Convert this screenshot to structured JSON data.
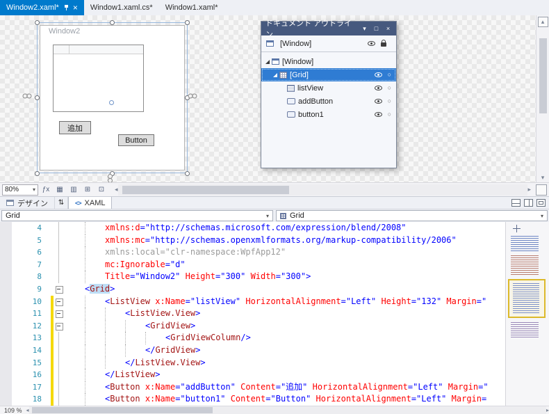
{
  "tabs": [
    {
      "label": "Window2.xaml*",
      "active": true
    },
    {
      "label": "Window1.xaml.cs*",
      "active": false
    },
    {
      "label": "Window1.xaml*",
      "active": false
    }
  ],
  "artboard": {
    "title": "Window2",
    "add_button_label": "追加",
    "button1_label": "Button"
  },
  "outline_panel": {
    "title": "ドキュメント アウトライン",
    "header_label": "[Window]",
    "tree": [
      {
        "label": "[Window]",
        "level": 0,
        "icon": "window",
        "expander": true,
        "selected": false,
        "eye": false,
        "circle": false
      },
      {
        "label": "[Grid]",
        "level": 1,
        "icon": "grid",
        "expander": true,
        "selected": true,
        "eye": true,
        "circle": true
      },
      {
        "label": "listView",
        "level": 2,
        "icon": "listview",
        "expander": false,
        "selected": false,
        "eye": true,
        "circle": true
      },
      {
        "label": "addButton",
        "level": 2,
        "icon": "button",
        "expander": false,
        "selected": false,
        "eye": true,
        "circle": true
      },
      {
        "label": "button1",
        "level": 2,
        "icon": "button",
        "expander": false,
        "selected": false,
        "eye": true,
        "circle": true
      }
    ]
  },
  "designer_toolbar": {
    "zoom": "80%"
  },
  "pane_switcher": {
    "design_label": "デザイン",
    "xaml_label": "XAML"
  },
  "breadcrumbs": {
    "left": "Grid",
    "right": "Grid"
  },
  "editor": {
    "status_zoom": "109 %",
    "lines": [
      {
        "n": 4,
        "ind": 2,
        "chg": false,
        "fold": "line",
        "tok": [
          [
            "a",
            "xmlns:d"
          ],
          [
            "d",
            "="
          ],
          [
            "v",
            "\"http://schemas.microsoft.com/expression/blend/2008\""
          ]
        ]
      },
      {
        "n": 5,
        "ind": 2,
        "chg": false,
        "fold": "line",
        "tok": [
          [
            "a",
            "xmlns:mc"
          ],
          [
            "d",
            "="
          ],
          [
            "v",
            "\"http://schemas.openxmlformats.org/markup-compatibility/2006\""
          ]
        ]
      },
      {
        "n": 6,
        "ind": 2,
        "chg": false,
        "fold": "line",
        "tok": [
          [
            "g",
            "xmlns:local"
          ],
          [
            "g",
            "="
          ],
          [
            "g",
            "\"clr-namespace:WpfApp12\""
          ]
        ]
      },
      {
        "n": 7,
        "ind": 2,
        "chg": false,
        "fold": "line",
        "tok": [
          [
            "a",
            "mc:Ignorable"
          ],
          [
            "d",
            "="
          ],
          [
            "v",
            "\"d\""
          ]
        ]
      },
      {
        "n": 8,
        "ind": 2,
        "chg": false,
        "fold": "line",
        "tok": [
          [
            "a",
            "Title"
          ],
          [
            "d",
            "="
          ],
          [
            "v",
            "\"Window2\""
          ],
          [
            "t",
            " "
          ],
          [
            "a",
            "Height"
          ],
          [
            "d",
            "="
          ],
          [
            "v",
            "\"300\""
          ],
          [
            "t",
            " "
          ],
          [
            "a",
            "Width"
          ],
          [
            "d",
            "="
          ],
          [
            "v",
            "\"300\""
          ],
          [
            "d",
            ">"
          ]
        ]
      },
      {
        "n": 9,
        "ind": 1,
        "chg": false,
        "fold": "box",
        "tok": [
          [
            "d",
            "<"
          ],
          [
            "h",
            "Grid"
          ],
          [
            "d",
            ">"
          ]
        ]
      },
      {
        "n": 10,
        "ind": 2,
        "chg": true,
        "fold": "box",
        "tok": [
          [
            "d",
            "<"
          ],
          [
            "e",
            "ListView"
          ],
          [
            "t",
            " "
          ],
          [
            "a",
            "x:Name"
          ],
          [
            "d",
            "="
          ],
          [
            "v",
            "\"listView\""
          ],
          [
            "t",
            " "
          ],
          [
            "a",
            "HorizontalAlignment"
          ],
          [
            "d",
            "="
          ],
          [
            "v",
            "\"Left\""
          ],
          [
            "t",
            " "
          ],
          [
            "a",
            "Height"
          ],
          [
            "d",
            "="
          ],
          [
            "v",
            "\"132\""
          ],
          [
            "t",
            " "
          ],
          [
            "a",
            "Margin"
          ],
          [
            "d",
            "="
          ],
          [
            "v",
            "\""
          ]
        ]
      },
      {
        "n": 11,
        "ind": 3,
        "chg": true,
        "fold": "box",
        "tok": [
          [
            "d",
            "<"
          ],
          [
            "e",
            "ListView.View"
          ],
          [
            "d",
            ">"
          ]
        ]
      },
      {
        "n": 12,
        "ind": 4,
        "chg": true,
        "fold": "box",
        "tok": [
          [
            "d",
            "<"
          ],
          [
            "e",
            "GridView"
          ],
          [
            "d",
            ">"
          ]
        ]
      },
      {
        "n": 13,
        "ind": 5,
        "chg": true,
        "fold": "line",
        "tok": [
          [
            "d",
            "<"
          ],
          [
            "e",
            "GridViewColumn"
          ],
          [
            "d",
            "/>"
          ]
        ]
      },
      {
        "n": 14,
        "ind": 4,
        "chg": true,
        "fold": "line",
        "tok": [
          [
            "d",
            "</"
          ],
          [
            "e",
            "GridView"
          ],
          [
            "d",
            ">"
          ]
        ]
      },
      {
        "n": 15,
        "ind": 3,
        "chg": true,
        "fold": "line",
        "tok": [
          [
            "d",
            "</"
          ],
          [
            "e",
            "ListView.View"
          ],
          [
            "d",
            ">"
          ]
        ]
      },
      {
        "n": 16,
        "ind": 2,
        "chg": true,
        "fold": "line",
        "tok": [
          [
            "d",
            "</"
          ],
          [
            "e",
            "ListView"
          ],
          [
            "d",
            ">"
          ]
        ]
      },
      {
        "n": 17,
        "ind": 2,
        "chg": true,
        "fold": "line",
        "tok": [
          [
            "d",
            "<"
          ],
          [
            "e",
            "Button"
          ],
          [
            "t",
            " "
          ],
          [
            "a",
            "x:Name"
          ],
          [
            "d",
            "="
          ],
          [
            "v",
            "\"addButton\""
          ],
          [
            "t",
            " "
          ],
          [
            "a",
            "Content"
          ],
          [
            "d",
            "="
          ],
          [
            "v",
            "\"追加\""
          ],
          [
            "t",
            " "
          ],
          [
            "a",
            "HorizontalAlignment"
          ],
          [
            "d",
            "="
          ],
          [
            "v",
            "\"Left\""
          ],
          [
            "t",
            " "
          ],
          [
            "a",
            "Margin"
          ],
          [
            "d",
            "="
          ],
          [
            "v",
            "\""
          ]
        ]
      },
      {
        "n": 18,
        "ind": 2,
        "chg": true,
        "fold": "line",
        "tok": [
          [
            "d",
            "<"
          ],
          [
            "e",
            "Button"
          ],
          [
            "t",
            " "
          ],
          [
            "a",
            "x:Name"
          ],
          [
            "d",
            "="
          ],
          [
            "v",
            "\"button1\""
          ],
          [
            "t",
            " "
          ],
          [
            "a",
            "Content"
          ],
          [
            "d",
            "="
          ],
          [
            "v",
            "\"Button\""
          ],
          [
            "t",
            " "
          ],
          [
            "a",
            "HorizontalAlignment"
          ],
          [
            "d",
            "="
          ],
          [
            "v",
            "\"Left\""
          ],
          [
            "t",
            " "
          ],
          [
            "a",
            "Margin"
          ],
          [
            "d",
            "="
          ]
        ]
      }
    ]
  },
  "icons": {
    "chevron_down": "▾",
    "close": "×",
    "maximize": "□",
    "scroll_left": "◂",
    "scroll_right": "▸",
    "scroll_up": "▴",
    "scroll_down": "▾",
    "swap": "⇅",
    "circle": "○",
    "effects": "ƒx",
    "grid": "▦",
    "grid2": "▥",
    "snap": "⊞",
    "guides": "⊡",
    "xaml_tag": "<>"
  },
  "colors": {
    "accent": "#007acc",
    "change_bar": "#f5d908",
    "element": "#a31515",
    "attribute": "#ff0000",
    "value": "#0000ff",
    "line_number": "#2b91af"
  }
}
